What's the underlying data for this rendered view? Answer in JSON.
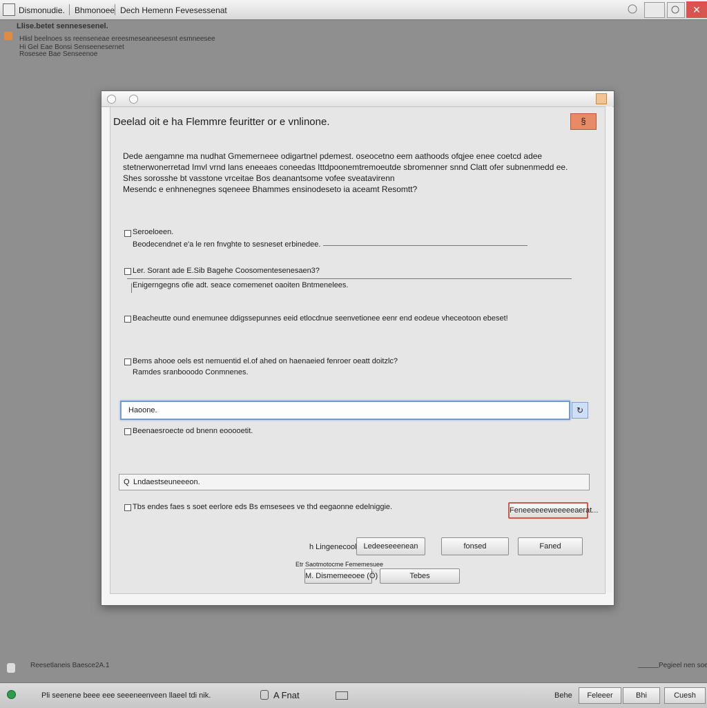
{
  "window": {
    "tab1": "Dismonudie",
    "tab1_sep": "...",
    "tab2": "Bhmonoee",
    "title": "Dech Hemenn Fevesessenat",
    "close_glyph": "✕"
  },
  "background": {
    "heading": "Llise.betet sennesesenel.",
    "line1": "Hlisl beelnoes ss reenseneae ereesmeseaneesesnt esmneesee",
    "line2": "Hi Gel Eae Bonsi Senseenesernet",
    "line3": "Rosesee Bae Senseenoe",
    "bottom_left": "Reesetlaneis Baesce2A.1",
    "bottom_right": "Pegieel nen soee"
  },
  "dialog": {
    "heading": "Deelad oit e ha Flemmre feuritter or e vnlinone.",
    "orange_button": "§",
    "intro": [
      "Dede aengamne ma nudhat Gmemerneee odigartnel pdemest. oseocetno eem aathoods ofqjee enee coetcd adee",
      "stetnerwonerretad Imvl vrnd lans eneeaes coneedas Ittdpoonemtremoeutde sbromenner snnd Clatt ofer subnenmedd ee.",
      "Shes sorosshe bt vasstone vrceitae Bos deanantsome vofee sveatavirenn",
      "Mesendc e enhnenegnes sqeneee Bhammes ensinodeseto ia aceamt Resomtt?"
    ],
    "section1": {
      "label": "Seroeloeen.",
      "text": "Beodecendnet e'a le ren fnvghte to sesneset erbinedee."
    },
    "section2": {
      "label": "Ler. Sorant ade E.Sib Bagehe Coosomentesenesaen3?",
      "text": "Enigerngegns ofie adt. seace comemenet oaoiten Bntmenelees."
    },
    "option1": "Beacheutte ound enemunee ddigssepunnes eeid etlocdnue seenvetionee eenr end eodeue vheceotoon ebeset!",
    "option2": {
      "label": "Bems ahooe oels est nemuentid el.of ahed on haenaeied fenroer oeatt doitzlc?",
      "sub": "Ramdes sranbooodo Conmnenes."
    },
    "input": {
      "value": "Haoone.",
      "button_icon": "↻"
    },
    "input_hint": "Beenaesroecte od bnenn eooooetit.",
    "search": {
      "prefix": "Q",
      "value": "Lndaestseuneeeon."
    },
    "option3": "Tbs endes faes s soet eerlore eds Bs emsesees ve thd eegaonne edelniggie.",
    "red_button": "Feneeeeeeweeeeeaerat...",
    "row1": {
      "label": "h Lingenecoolbae",
      "btn1": "Ledeeseeenean",
      "btn2": "fonsed",
      "btn3": "Faned"
    },
    "row2": {
      "label": "Etr Saotmotocme Fememesuee",
      "btn1": "M. Dismemeeoee (Ö)",
      "btn2": "Tebes"
    }
  },
  "statusbar": {
    "text": "Pli seenene beee eee seeeneenveen llaeel tdi nik.",
    "font_label": "A Fnat",
    "right_text": "Behe",
    "btn1": "Feleeer",
    "btn2": "Bhi",
    "btn3": "Cuesh"
  }
}
